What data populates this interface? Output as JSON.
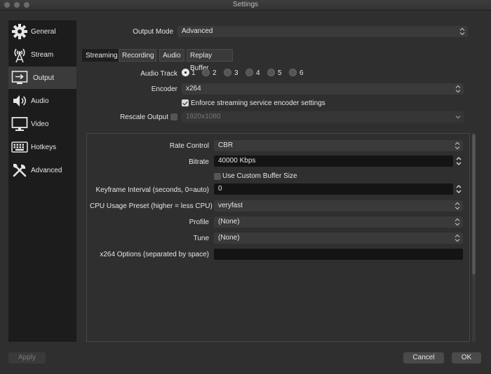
{
  "window": {
    "title": "Settings"
  },
  "sidebar": {
    "items": [
      {
        "label": "General",
        "icon": "gear-icon"
      },
      {
        "label": "Stream",
        "icon": "antenna-icon"
      },
      {
        "label": "Output",
        "icon": "output-icon",
        "selected": true
      },
      {
        "label": "Audio",
        "icon": "speaker-icon"
      },
      {
        "label": "Video",
        "icon": "monitor-icon"
      },
      {
        "label": "Hotkeys",
        "icon": "keyboard-icon"
      },
      {
        "label": "Advanced",
        "icon": "tools-icon"
      }
    ]
  },
  "output_mode": {
    "label": "Output Mode",
    "value": "Advanced"
  },
  "tabs": [
    {
      "label": "Streaming",
      "active": true
    },
    {
      "label": "Recording"
    },
    {
      "label": "Audio"
    },
    {
      "label": "Replay Buffer"
    }
  ],
  "streaming": {
    "audio_track": {
      "label": "Audio Track",
      "options": [
        "1",
        "2",
        "3",
        "4",
        "5",
        "6"
      ],
      "selected": "1"
    },
    "encoder": {
      "label": "Encoder",
      "value": "x264"
    },
    "enforce": {
      "label": "Enforce streaming service encoder settings",
      "checked": true
    },
    "rescale": {
      "label": "Rescale Output",
      "value": "1920x1080",
      "checked": false
    }
  },
  "encoder_settings": {
    "rate_control": {
      "label": "Rate Control",
      "value": "CBR"
    },
    "bitrate": {
      "label": "Bitrate",
      "value": "40000 Kbps"
    },
    "custom_buffer": {
      "label": "Use Custom Buffer Size",
      "checked": false
    },
    "keyframe": {
      "label": "Keyframe Interval (seconds, 0=auto)",
      "value": "0"
    },
    "cpu_preset": {
      "label": "CPU Usage Preset (higher = less CPU)",
      "value": "veryfast"
    },
    "profile": {
      "label": "Profile",
      "value": "(None)"
    },
    "tune": {
      "label": "Tune",
      "value": "(None)"
    },
    "x264_options": {
      "label": "x264 Options (separated by space)",
      "value": ""
    }
  },
  "buttons": {
    "apply": "Apply",
    "cancel": "Cancel",
    "ok": "OK"
  }
}
